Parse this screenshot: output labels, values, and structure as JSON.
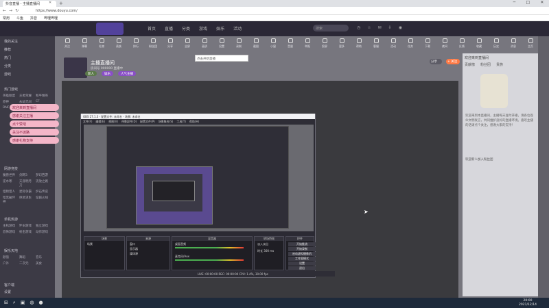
{
  "browser": {
    "tab_title": "抖音直播 - 主播直播间",
    "url": "https://www.douyu.com/",
    "bookmarks": [
      "常用",
      "斗鱼",
      "抖音",
      "哔哩哔哩"
    ]
  },
  "header": {
    "nav": [
      "首页",
      "直播",
      "分类",
      "游戏",
      "娱乐",
      "活动"
    ],
    "search_placeholder": "搜索",
    "icons": [
      "history-icon",
      "star-icon",
      "message-icon",
      "download-icon",
      "user-icon"
    ]
  },
  "sidebar": {
    "top_items": [
      "我的关注",
      "推荐",
      "热门",
      "分类",
      "游戏"
    ],
    "sections": [
      {
        "label": "热门游戏",
        "grid": [
          "英雄联盟",
          "王者荣耀",
          "和平精英",
          "原神",
          "永劫无间",
          "CF",
          "DNF",
          "DOTA2",
          "APEX"
        ]
      },
      {
        "label": "网游竞技",
        "grid": [
          "魔兽世界",
          "剑网3",
          "梦幻西游",
          "逆水寒",
          "天涯明月刀",
          "流放之路",
          "怪物猎人",
          "星际争霸",
          "炉石传说",
          "暗黑破坏神",
          "绝地求生",
          "穿越火线"
        ]
      },
      {
        "label": "单机热游",
        "grid": [
          "主机游戏",
          "怀旧游戏",
          "独立游戏",
          "恐怖游戏",
          "射击游戏",
          "动作游戏"
        ]
      },
      {
        "label": "娱乐天地",
        "grid": [
          "颜值",
          "舞蹈",
          "音乐",
          "户外",
          "二次元",
          "美食"
        ]
      }
    ],
    "bottom_items": [
      "客户端",
      "设置"
    ]
  },
  "overlay_items": [
    "欢迎来到直播间",
    "感谢关注主播",
    "点个赞吧",
    "关注不迷路",
    "感谢礼物支持"
  ],
  "toolbar": [
    "关注",
    "弹幕",
    "礼物",
    "贵族",
    "排行",
    "粉丝团",
    "分享",
    "全屏",
    "画质",
    "设置",
    "录制",
    "截图",
    "小窗",
    "音量",
    "举报",
    "投屏",
    "更多",
    "帮助",
    "客服",
    "活动",
    "任务",
    "下载",
    "夜间",
    "反馈",
    "收藏",
    "历史",
    "消息",
    "主页"
  ],
  "tooltip": "点击开始直播",
  "streamer": {
    "name": "主播直播间",
    "sub": "房间号 000000  直播中",
    "pills": [
      "新人",
      "娱乐",
      "人气主播"
    ],
    "share_label": "分享",
    "follow_label": "+ 关注"
  },
  "right_panel": {
    "header": "欢迎来到直播间",
    "tabs": [
      "贡献榜",
      "粉丝团",
      "贵族"
    ],
    "text": "欢迎来到本直播间，主播每天准时开播，请各位观众文明发言，共同维护良好的直播环境。喜欢主播的话请点个关注，感谢大家的支持！",
    "note": "欢迎新人加入粉丝团"
  },
  "obs": {
    "title": "OBS 27.1.3 - 配置文件: 未命名 - 场景: 未命名",
    "menu": [
      "文件(F)",
      "编辑(E)",
      "视图(V)",
      "停靠部件(D)",
      "配置文件(P)",
      "场景集合(S)",
      "工具(T)",
      "帮助(H)"
    ],
    "docks": {
      "scenes": {
        "title": "场景",
        "items": [
          "场景"
        ]
      },
      "sources": {
        "title": "来源",
        "items": [
          "窗口",
          "显示器",
          "媒体源"
        ]
      },
      "mixer": {
        "title": "混音器",
        "channels": [
          "桌面音频",
          "麦克风/Aux"
        ]
      },
      "transitions": {
        "title": "转场特效",
        "items": [
          "淡入淡出",
          "时长 300 ms"
        ]
      },
      "controls": {
        "title": "控件",
        "buttons": [
          "开始推流",
          "开始录制",
          "启动虚拟摄像机",
          "工作室模式",
          "设置",
          "退出"
        ]
      }
    },
    "status": "LIVE: 00:00:00   REC: 00:00:00   CPU: 1.4%, 30.00 fps"
  },
  "taskbar": {
    "time": "20:00",
    "date": "2021/12/14"
  }
}
